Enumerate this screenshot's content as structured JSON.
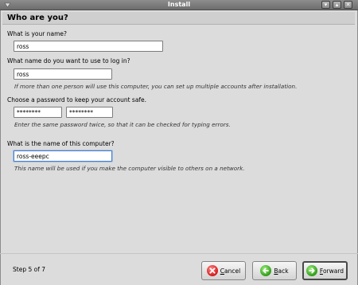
{
  "window": {
    "title": "Install"
  },
  "page": {
    "heading": "Who are you?"
  },
  "name_section": {
    "label": "What is your name?",
    "value": "ross"
  },
  "login_section": {
    "label": "What name do you want to use to log in?",
    "value": "ross",
    "hint": "If more than one person will use this computer, you can set up multiple accounts after installation."
  },
  "password_section": {
    "label": "Choose a password to keep your account safe.",
    "value": "********",
    "confirm_value": "********",
    "hint": "Enter the same password twice, so that it can be checked for typing errors."
  },
  "computer_section": {
    "label": "What is the name of this computer?",
    "value": "ross-eeepc",
    "hint": "This name will be used if you make the computer visible to others on a network."
  },
  "footer": {
    "step": "Step 5 of 7",
    "cancel_prefix": "",
    "cancel_ul": "C",
    "cancel_rest": "ancel",
    "back_ul": "B",
    "back_rest": "ack",
    "forward_ul": "F",
    "forward_rest": "orward"
  },
  "colors": {
    "titlebar": "#7a7a7a",
    "focus": "#4c7fc4",
    "cancel_icon": "#d31a1a",
    "nav_icon": "#2f9b18"
  },
  "icons": [
    "window-icon",
    "minimize-icon",
    "close-icon",
    "cancel-icon",
    "back-arrow-icon",
    "forward-arrow-icon"
  ]
}
